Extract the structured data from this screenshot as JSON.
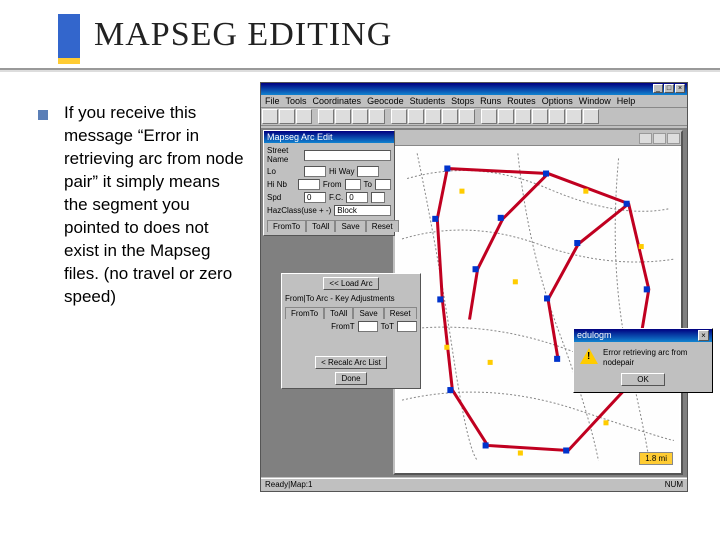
{
  "slide": {
    "title": "MAPSEG EDITING",
    "body": "If you receive this message “Error in retrieving arc from node pair” it simply means the segment you pointed to does not exist in the Mapseg files. (no travel or zero speed)"
  },
  "app": {
    "title": "",
    "menu": [
      "File",
      "Tools",
      "Coordinates",
      "Geocode",
      "Students",
      "Stops",
      "Runs",
      "Routes",
      "Options",
      "Window",
      "Help"
    ],
    "statusbar_left": "Ready|Map:1",
    "statusbar_right": "NUM"
  },
  "arc_panel": {
    "header": "Mapseg Arc Edit",
    "street_label": "Street Name",
    "street_value": "",
    "lo_label": "Lo",
    "lo_value": "",
    "hiway_label": "Hi Way",
    "hiway_value": "",
    "hinb_label": "Hi Nb",
    "hinb_value": "",
    "from_label": "From",
    "from_value": "",
    "to_label": "To",
    "to_value": "",
    "spd_label": "Spd",
    "spd_value": "0",
    "fc_label": "F.C.",
    "fc_value": "0",
    "dir_label": "",
    "hazard_label": "HazClass(use + -)",
    "hazard_value": "Block",
    "tabs": [
      "FromTo",
      "ToAll",
      "Save",
      "Reset"
    ]
  },
  "adj_panel": {
    "pick_btn": "<< Load Arc",
    "group_title": "From|To Arc - Key Adjustments",
    "tabs": [
      "FromTo",
      "ToAll",
      "Save",
      "Reset"
    ],
    "from_label": "FromT",
    "to_label": "ToT",
    "recalc_btn": "< Recalc Arc List",
    "done_btn": "Done"
  },
  "error_dialog": {
    "title": "edulogm",
    "message": "Error retrieving arc from nodepair",
    "ok": "OK"
  },
  "map": {
    "scale": "1.8 mi"
  }
}
